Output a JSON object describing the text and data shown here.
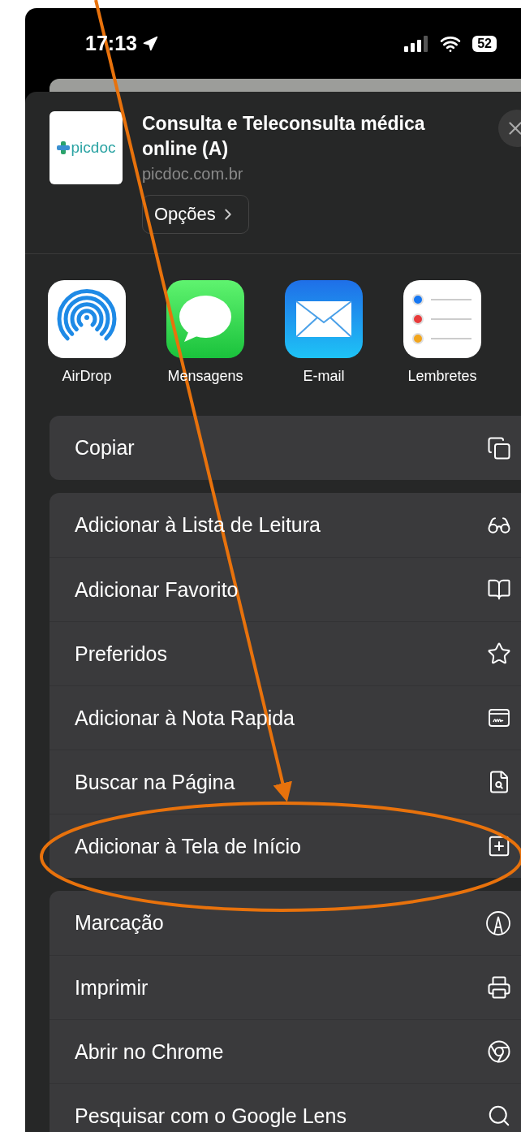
{
  "status_bar": {
    "time": "17:13",
    "battery": "52"
  },
  "header": {
    "logo_text": "picdoc",
    "title": "Consulta e Teleconsulta médica online (A)",
    "domain": "picdoc.com.br",
    "options_button": "Opções"
  },
  "apps": [
    {
      "label": "AirDrop",
      "kind": "airdrop"
    },
    {
      "label": "Mensagens",
      "kind": "messages"
    },
    {
      "label": "E-mail",
      "kind": "mail"
    },
    {
      "label": "Lembretes",
      "kind": "reminders"
    }
  ],
  "action_groups": [
    [
      {
        "label": "Copiar",
        "kind": "copy"
      }
    ],
    [
      {
        "label": "Adicionar à Lista de Leitura",
        "kind": "glasses"
      },
      {
        "label": "Adicionar Favorito",
        "kind": "book"
      },
      {
        "label": "Preferidos",
        "kind": "star"
      },
      {
        "label": "Adicionar à Nota Rapida",
        "kind": "note"
      },
      {
        "label": "Buscar na Página",
        "kind": "find"
      },
      {
        "label": "Adicionar à Tela de Início",
        "kind": "add"
      }
    ],
    [
      {
        "label": "Marcação",
        "kind": "markup"
      },
      {
        "label": "Imprimir",
        "kind": "print"
      },
      {
        "label": "Abrir no Chrome",
        "kind": "chrome"
      },
      {
        "label": "Pesquisar com o Google Lens",
        "kind": "search"
      }
    ]
  ]
}
